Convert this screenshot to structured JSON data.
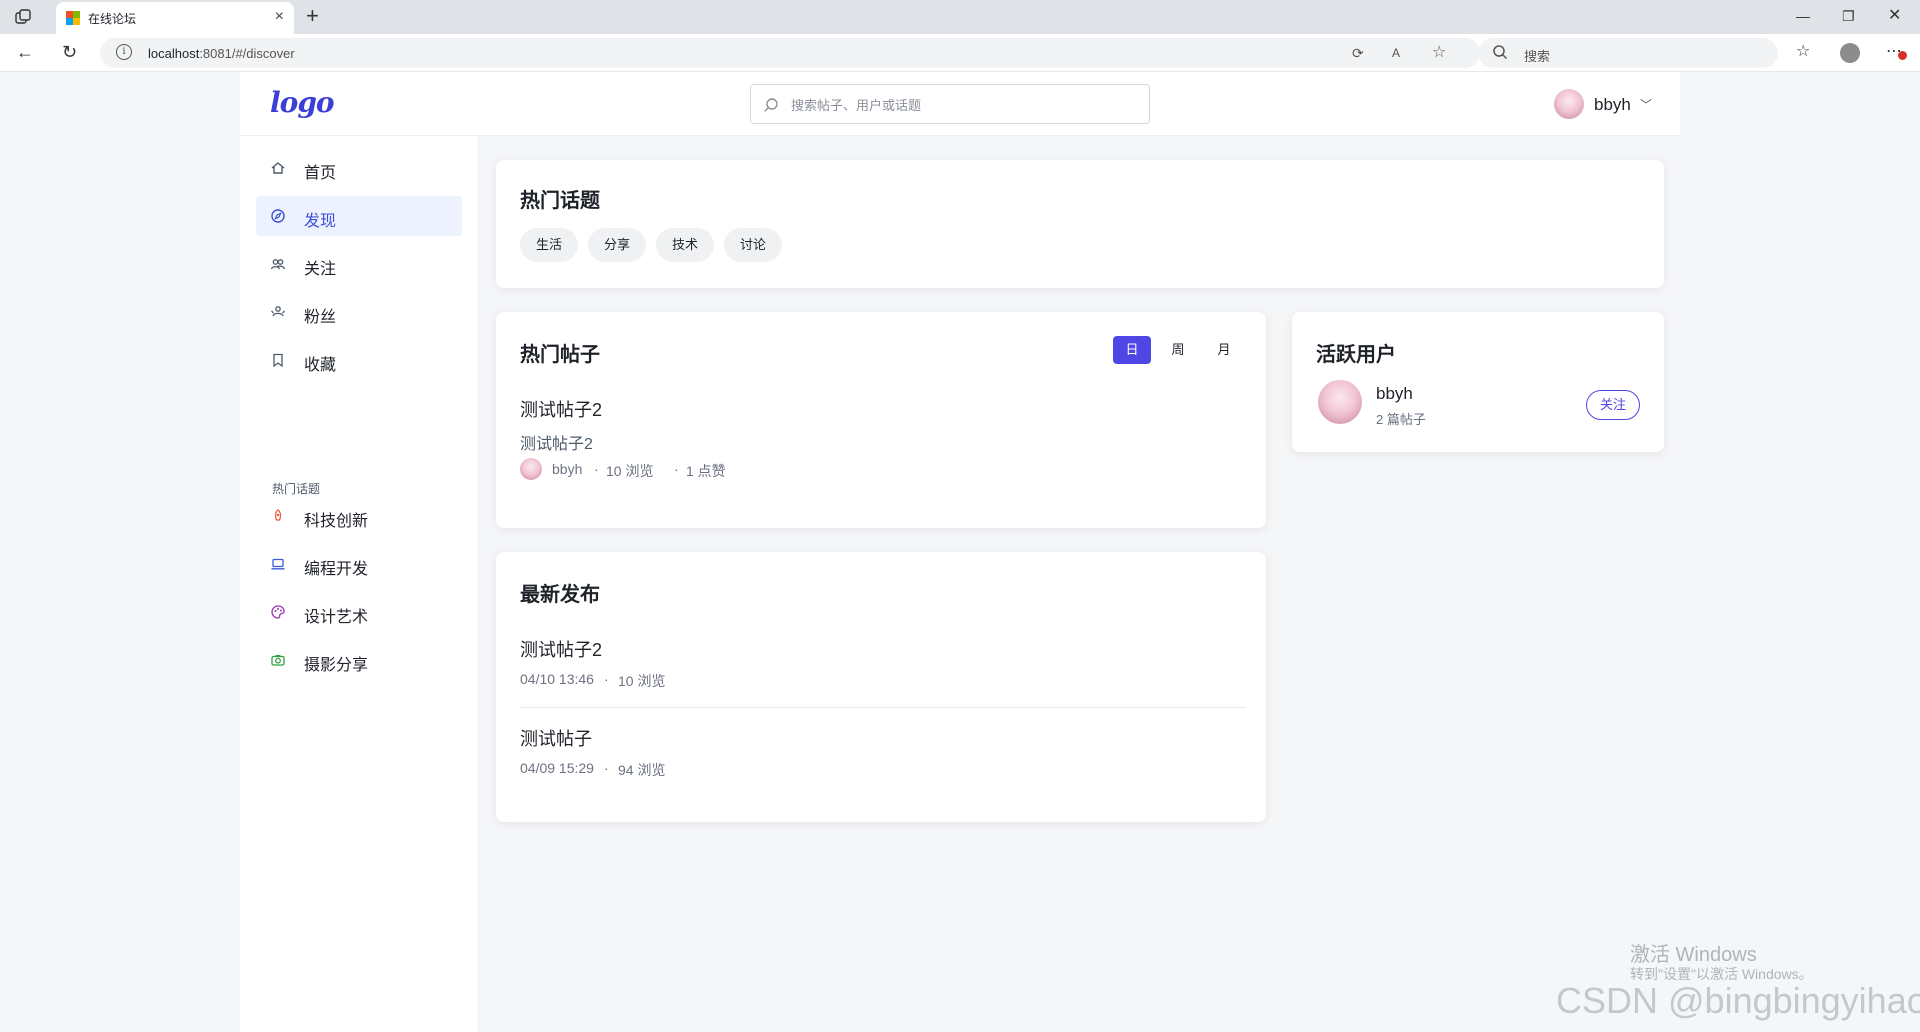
{
  "browser": {
    "tab_title": "在线论坛",
    "url_host": "localhost",
    "url_rest": ":8081/#/discover",
    "search_placeholder": "搜索"
  },
  "header": {
    "logo": "logo",
    "search_placeholder": "搜索帖子、用户或话题",
    "user_name": "bbyh"
  },
  "sidebar": {
    "nav": [
      {
        "label": "首页",
        "icon": "home-icon",
        "active": false
      },
      {
        "label": "发现",
        "icon": "compass-icon",
        "active": true
      },
      {
        "label": "关注",
        "icon": "users-icon",
        "active": false
      },
      {
        "label": "粉丝",
        "icon": "fans-icon",
        "active": false
      },
      {
        "label": "收藏",
        "icon": "bookmark-icon",
        "active": false
      }
    ],
    "topics_heading": "热门话题",
    "topics": [
      {
        "label": "科技创新",
        "icon": "rocket-icon",
        "color": "#f05a3c"
      },
      {
        "label": "编程开发",
        "icon": "laptop-icon",
        "color": "#3b5bdb"
      },
      {
        "label": "设计艺术",
        "icon": "palette-icon",
        "color": "#9c36b5"
      },
      {
        "label": "摄影分享",
        "icon": "camera-icon",
        "color": "#2f9e44"
      }
    ]
  },
  "hot_topics": {
    "title": "热门话题",
    "tags": [
      "生活",
      "分享",
      "技术",
      "讨论"
    ]
  },
  "hot_posts": {
    "title": "热门帖子",
    "ranges": [
      "日",
      "周",
      "月"
    ],
    "active_range": "日",
    "items": [
      {
        "title": "测试帖子2",
        "excerpt": "测试帖子2",
        "author": "bbyh",
        "views": "10 浏览",
        "likes": "1 点赞"
      }
    ]
  },
  "latest": {
    "title": "最新发布",
    "items": [
      {
        "title": "测试帖子2",
        "time": "04/10 13:46",
        "views": "10 浏览"
      },
      {
        "title": "测试帖子",
        "time": "04/09 15:29",
        "views": "94 浏览"
      }
    ]
  },
  "active_users": {
    "title": "活跃用户",
    "users": [
      {
        "name": "bbyh",
        "posts": "2 篇帖子",
        "follow_label": "关注"
      }
    ]
  },
  "meta_separator": "·",
  "watermarks": {
    "activate_title": "激活 Windows",
    "activate_sub": "转到\"设置\"以激活 Windows。",
    "csdn": "CSDN @bingbingyihao"
  },
  "colors": {
    "accent": "#4f46e5",
    "active_nav_bg": "#eef2ff"
  }
}
